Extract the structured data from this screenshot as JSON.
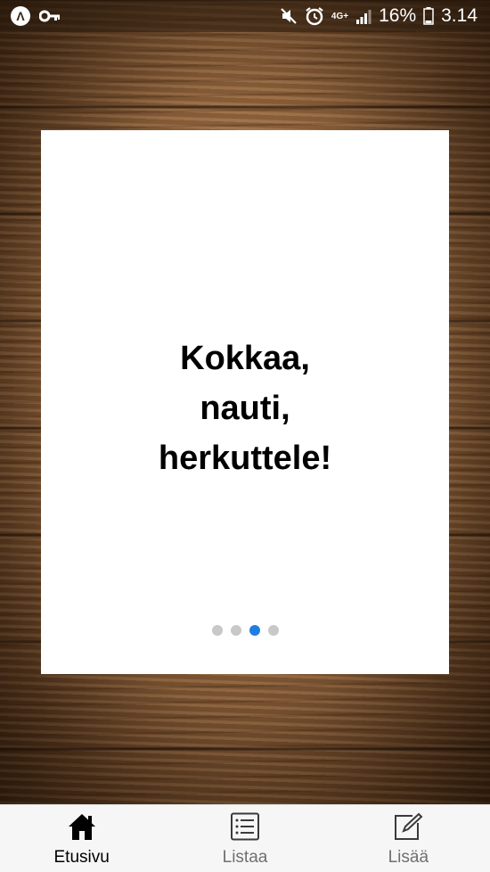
{
  "status_bar": {
    "battery_percent": "16%",
    "time": "3.14",
    "network": "4G+",
    "left_icons": [
      "app-a-icon",
      "key-icon"
    ],
    "right_icons": [
      "mute-icon",
      "alarm-icon",
      "network-4g-icon",
      "signal-icon",
      "battery-icon"
    ]
  },
  "card": {
    "slogan_lines": [
      "Kokkaa,",
      "nauti,",
      "herkuttele!"
    ],
    "pager": {
      "count": 4,
      "active_index": 2
    }
  },
  "bottom_nav": {
    "items": [
      {
        "label": "Etusivu",
        "icon": "home-icon",
        "active": true
      },
      {
        "label": "Listaa",
        "icon": "list-icon",
        "active": false
      },
      {
        "label": "Lisää",
        "icon": "edit-icon",
        "active": false
      }
    ]
  },
  "colors": {
    "accent": "#1f7fe0",
    "inactive_dot": "#c8c8c8",
    "nav_inactive": "#6f6f6f"
  }
}
